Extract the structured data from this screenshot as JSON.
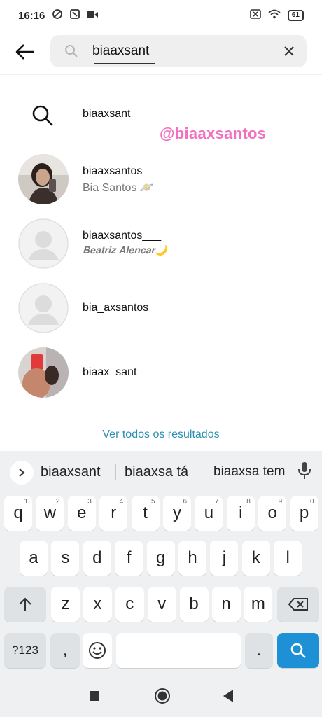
{
  "status_bar": {
    "time": "16:16",
    "battery": "61"
  },
  "search": {
    "value": "biaaxsant"
  },
  "query_suggestion": {
    "text": "biaaxsant"
  },
  "overlay_handle": "@biaaxsantos",
  "results": [
    {
      "username": "biaaxsantos",
      "fullname": "Bia Santos 🪐"
    },
    {
      "username": "biaaxsantos___",
      "fullname": "𝐁𝐞𝐚𝐭𝐫𝐢𝐳 𝐀𝐥𝐞𝐧𝐜𝐚𝐫🌙"
    },
    {
      "username": "bia_axsantos",
      "fullname": ""
    },
    {
      "username": "biaax_sant",
      "fullname": ""
    }
  ],
  "see_all_label": "Ver todos os resultados",
  "keyboard": {
    "suggestions": [
      "biaaxsant",
      "biaaxsa tá",
      "biaaxsa tem"
    ],
    "row1": [
      {
        "k": "q",
        "h": "1"
      },
      {
        "k": "w",
        "h": "2"
      },
      {
        "k": "e",
        "h": "3"
      },
      {
        "k": "r",
        "h": "4"
      },
      {
        "k": "t",
        "h": "5"
      },
      {
        "k": "y",
        "h": "6"
      },
      {
        "k": "u",
        "h": "7"
      },
      {
        "k": "i",
        "h": "8"
      },
      {
        "k": "o",
        "h": "9"
      },
      {
        "k": "p",
        "h": "0"
      }
    ],
    "row2": [
      "a",
      "s",
      "d",
      "f",
      "g",
      "h",
      "j",
      "k",
      "l"
    ],
    "row3": [
      "z",
      "x",
      "c",
      "v",
      "b",
      "n",
      "m"
    ],
    "symbols_label": "?123",
    "comma_label": ",",
    "period_label": "."
  },
  "colors": {
    "accent": "#2a8fb0",
    "enter": "#1e90d6",
    "handle_pink": "#f36fbf"
  }
}
